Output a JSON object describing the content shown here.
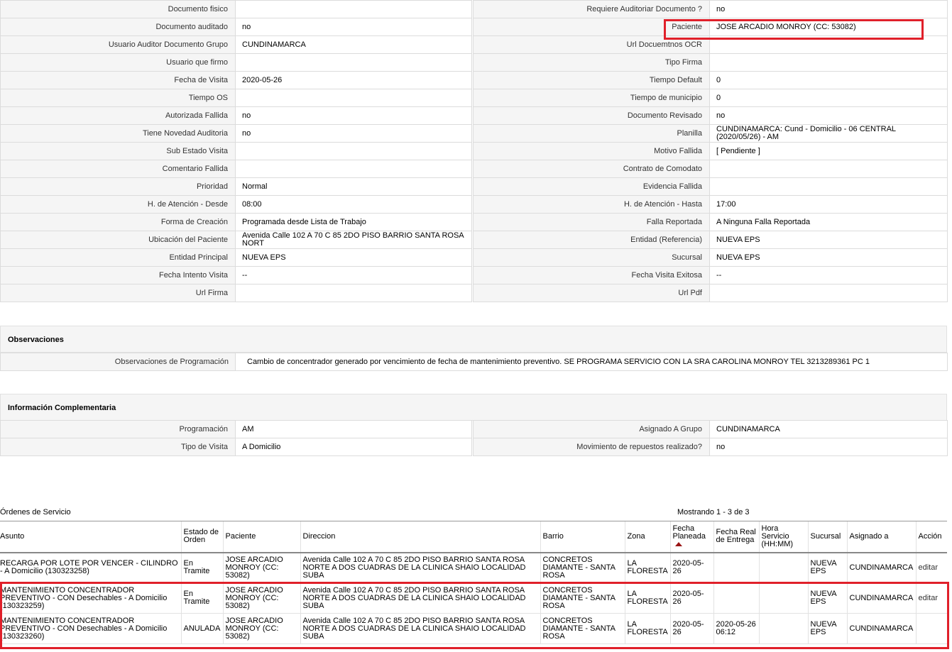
{
  "details": [
    {
      "l1": "Documento fisico",
      "v1": "",
      "l2": "Requiere Auditoriar Documento ?",
      "v2": "no"
    },
    {
      "l1": "Documento auditado",
      "v1": "no",
      "l2": "Paciente",
      "v2": "JOSE ARCADIO MONROY (CC: 53082)"
    },
    {
      "l1": "Usuario Auditor Documento Grupo",
      "v1": "CUNDINAMARCA",
      "l2": "Url Docuemtnos OCR",
      "v2": ""
    },
    {
      "l1": "Usuario que firmo",
      "v1": "",
      "l2": "Tipo Firma",
      "v2": ""
    },
    {
      "l1": "Fecha de Visita",
      "v1": "2020-05-26",
      "l2": "Tiempo Default",
      "v2": "0"
    },
    {
      "l1": "Tiempo OS",
      "v1": "",
      "l2": "Tiempo de municipio",
      "v2": "0"
    },
    {
      "l1": "Autorizada Fallida",
      "v1": "no",
      "l2": "Documento Revisado",
      "v2": "no"
    },
    {
      "l1": "Tiene Novedad Auditoria",
      "v1": "no",
      "l2": "Planilla",
      "v2": "CUNDINAMARCA: Cund - Domicilio - 06 CENTRAL (2020/05/26) - AM"
    },
    {
      "l1": "Sub Estado Visita",
      "v1": "",
      "l2": "Motivo Fallida",
      "v2": "[ Pendiente ]"
    },
    {
      "l1": "Comentario Fallida",
      "v1": "",
      "l2": "Contrato de Comodato",
      "v2": ""
    },
    {
      "l1": "Prioridad",
      "v1": "Normal",
      "l2": "Evidencia Fallida",
      "v2": ""
    },
    {
      "l1": "H. de Atención - Desde",
      "v1": "08:00",
      "l2": "H. de Atención - Hasta",
      "v2": "17:00"
    },
    {
      "l1": "Forma de Creación",
      "v1": "Programada desde Lista de Trabajo",
      "l2": "Falla Reportada",
      "v2": "A Ninguna Falla Reportada"
    },
    {
      "l1": "Ubicación del Paciente",
      "v1": "Avenida Calle 102 A 70 C 85 2DO PISO BARRIO SANTA ROSA NORT",
      "l2": "Entidad (Referencia)",
      "v2": "NUEVA EPS"
    },
    {
      "l1": "Entidad Principal",
      "v1": "NUEVA EPS",
      "l2": "Sucursal",
      "v2": "NUEVA EPS"
    },
    {
      "l1": "Fecha Intento Visita",
      "v1": "--",
      "l2": "Fecha Visita Exitosa",
      "v2": "--"
    },
    {
      "l1": "Url Firma",
      "v1": "",
      "l2": "Url Pdf",
      "v2": ""
    }
  ],
  "observaciones": {
    "title": "Observaciones",
    "label": "Observaciones de Programación",
    "value": "Cambio de concentrador generado por vencimiento de fecha de mantenimiento preventivo. SE PROGRAMA SERVICIO CON LA SRA CAROLINA MONROY TEL 3213289361 PC 1"
  },
  "complementaria": {
    "title": "Información Complementaria",
    "rows": [
      {
        "l1": "Programación",
        "v1": "AM",
        "l2": "Asignado A Grupo",
        "v2": "CUNDINAMARCA"
      },
      {
        "l1": "Tipo de Visita",
        "v1": "A Domicilio",
        "l2": "Movimiento de repuestos realizado?",
        "v2": "no"
      }
    ]
  },
  "orders": {
    "title": "Órdenes de Servicio",
    "count": "Mostrando 1 - 3 de 3",
    "columns": [
      "Asunto",
      "Estado de Orden",
      "Paciente",
      "Direccion",
      "Barrio",
      "Zona",
      "Fecha Planeada",
      "Fecha Real de Entrega",
      "Hora Servicio (HH:MM)",
      "Sucursal",
      "Asignado a",
      "Acción"
    ],
    "rows": [
      {
        "asunto": "RECARGA POR LOTE POR VENCER - CILINDRO - A Domicilio (130323258)",
        "estado": "En Tramite",
        "paciente": "JOSE ARCADIO MONROY (CC: 53082)",
        "direccion": "Avenida Calle 102 A 70 C 85 2DO PISO BARRIO SANTA ROSA NORTE A DOS CUADRAS DE LA CLINICA SHAIO LOCALIDAD SUBA",
        "barrio": "CONCRETOS DIAMANTE - SANTA ROSA",
        "zona": "LA FLORESTA",
        "fecha_planeada": "2020-05-26",
        "fecha_real": "",
        "hora": "",
        "sucursal": "NUEVA EPS",
        "asignado": "CUNDINAMARCA",
        "accion": "editar"
      },
      {
        "asunto": "MANTENIMIENTO CONCENTRADOR PREVENTIVO - CON Desechables - A Domicilio (130323259)",
        "estado": "En Tramite",
        "paciente": "JOSE ARCADIO MONROY (CC: 53082)",
        "direccion": "Avenida Calle 102 A 70 C 85 2DO PISO BARRIO SANTA ROSA NORTE A DOS CUADRAS DE LA CLINICA SHAIO LOCALIDAD SUBA",
        "barrio": "CONCRETOS DIAMANTE - SANTA ROSA",
        "zona": "LA FLORESTA",
        "fecha_planeada": "2020-05-26",
        "fecha_real": "",
        "hora": "",
        "sucursal": "NUEVA EPS",
        "asignado": "CUNDINAMARCA",
        "accion": "editar"
      },
      {
        "asunto": "MANTENIMIENTO CONCENTRADOR PREVENTIVO - CON Desechables - A Domicilio (130323260)",
        "estado": "ANULADA",
        "paciente": "JOSE ARCADIO MONROY (CC: 53082)",
        "direccion": "Avenida Calle 102 A 70 C 85 2DO PISO BARRIO SANTA ROSA NORTE A DOS CUADRAS DE LA CLINICA SHAIO LOCALIDAD SUBA",
        "barrio": "CONCRETOS DIAMANTE - SANTA ROSA",
        "zona": "LA FLORESTA",
        "fecha_planeada": "2020-05-26",
        "fecha_real": "2020-05-26 06:12",
        "hora": "",
        "sucursal": "NUEVA EPS",
        "asignado": "CUNDINAMARCA",
        "accion": ""
      }
    ]
  },
  "highlight_color": "#e0202a"
}
